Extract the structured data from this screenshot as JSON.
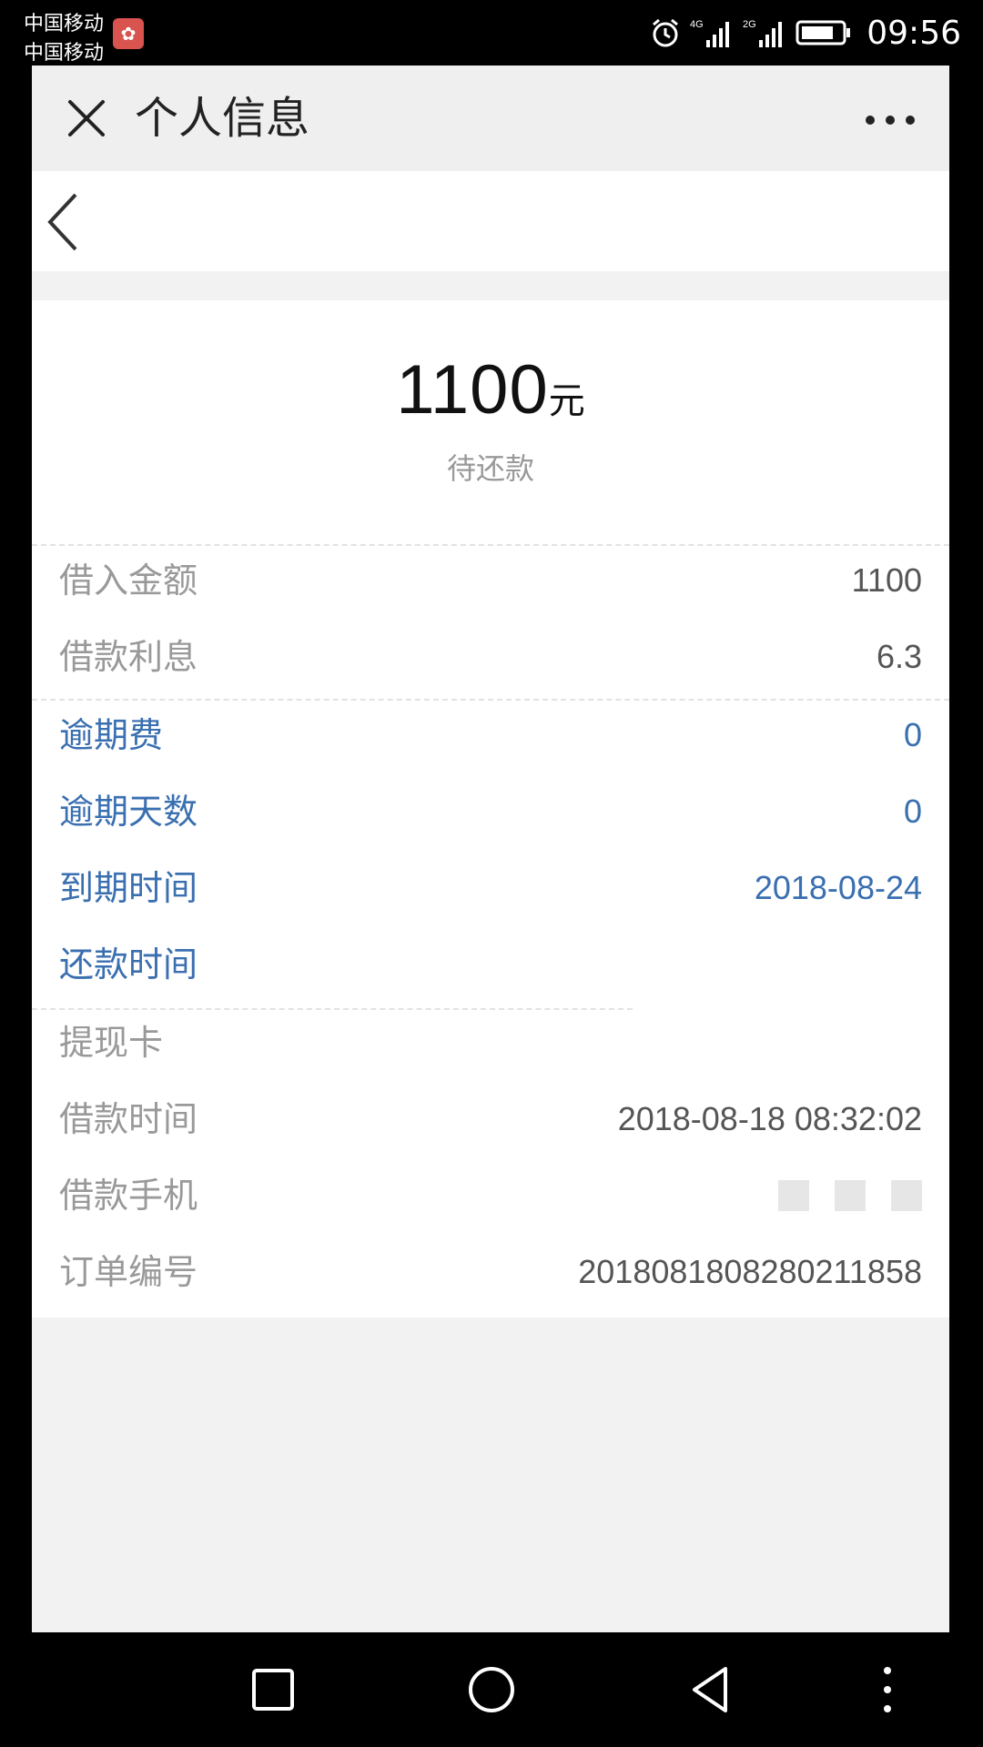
{
  "status_bar": {
    "carrier_1": "中国移动",
    "carrier_2": "中国移动",
    "network_1": "4G",
    "network_2": "2G",
    "time": "09:56"
  },
  "header": {
    "title": "个人信息"
  },
  "summary": {
    "amount": "1100",
    "unit": "元",
    "label": "待还款"
  },
  "details": [
    {
      "label": "借入金额",
      "value": "1100"
    },
    {
      "label": "借款利息",
      "value": "6.3"
    },
    {
      "label": "逾期费",
      "value": "0"
    },
    {
      "label": "逾期天数",
      "value": "0"
    },
    {
      "label": "到期时间",
      "value": "2018-08-24"
    },
    {
      "label": "还款时间",
      "value": ""
    },
    {
      "label": "提现卡",
      "value": ""
    },
    {
      "label": "借款时间",
      "value": "2018-08-18 08:32:02"
    },
    {
      "label": "借款手机",
      "value": ""
    },
    {
      "label": "订单编号",
      "value": "20180818082802118​58"
    }
  ],
  "colors": {
    "accent_blue": "#3a6fb0",
    "label_gray": "#999999",
    "page_bg": "#f2f2f2"
  }
}
